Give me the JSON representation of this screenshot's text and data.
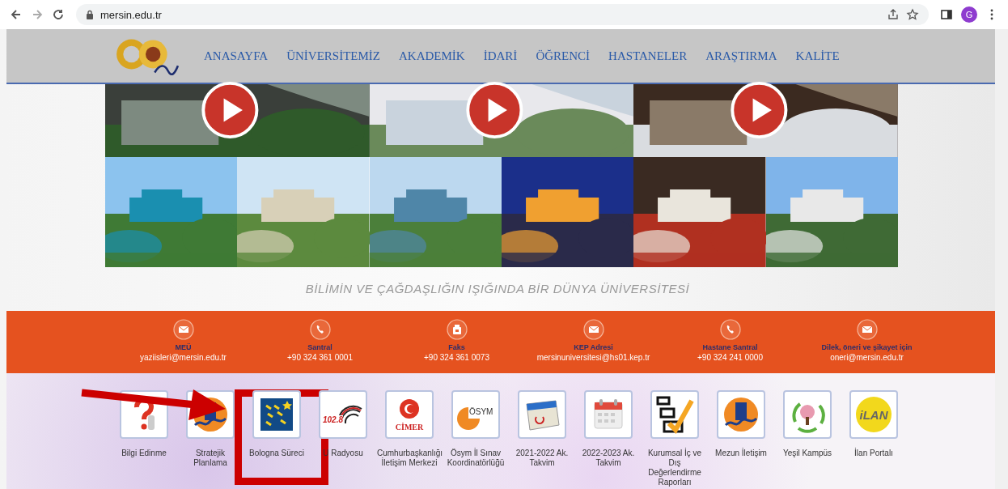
{
  "browser": {
    "url": "mersin.edu.tr",
    "profile_initial": "G"
  },
  "nav": {
    "items": [
      {
        "label": "ANASAYFA"
      },
      {
        "label": "ÜNİVERSİTEMİZ"
      },
      {
        "label": "AKADEMİK"
      },
      {
        "label": "İDARİ"
      },
      {
        "label": "ÖĞRENCİ"
      },
      {
        "label": "HASTANELER"
      },
      {
        "label": "ARAŞTIRMA"
      },
      {
        "label": "KALİTE"
      }
    ]
  },
  "slogan": "BİLİMİN VE ÇAĞDAŞLIĞIN IŞIĞINDA BİR DÜNYA ÜNİVERSİTESİ",
  "contacts": [
    {
      "kind": "mail",
      "label": "MEÜ",
      "value": "yaziisleri@mersin.edu.tr"
    },
    {
      "kind": "phone",
      "label": "Santral",
      "value": "+90 324 361 0001"
    },
    {
      "kind": "fax",
      "label": "Faks",
      "value": "+90 324 361 0073"
    },
    {
      "kind": "mail",
      "label": "KEP Adresi",
      "value": "mersinuniversitesi@hs01.kep.tr"
    },
    {
      "kind": "phone",
      "label": "Hastane Santral",
      "value": "+90 324 241 0000"
    },
    {
      "kind": "mail",
      "label": "Dilek, öneri ve şikayet için",
      "value": "oneri@mersin.edu.tr"
    }
  ],
  "links": [
    {
      "kind": "question",
      "label": "Bilgi Edinme",
      "highlighted": false
    },
    {
      "kind": "emblem",
      "label": "Stratejik Planlama",
      "highlighted": false
    },
    {
      "kind": "stars",
      "label": "Bologna Süreci",
      "highlighted": true
    },
    {
      "kind": "radio",
      "badge_text": "102.8",
      "label": "U Radyosu",
      "highlighted": false
    },
    {
      "kind": "cimer",
      "badge_text": "CİMER",
      "label": "Cumhurbaşkanlığı İletişim Merkezi",
      "highlighted": false
    },
    {
      "kind": "osym",
      "badge_text": "ÖSYM",
      "label": "Ösym İl Sınav Koordinatörlüğü",
      "highlighted": false
    },
    {
      "kind": "desk-calendar",
      "label": "2021-2022 Ak. Takvim",
      "highlighted": false
    },
    {
      "kind": "calendar",
      "label": "2022-2023 Ak. Takvim",
      "highlighted": false
    },
    {
      "kind": "checklist",
      "label": "Kurumsal İç ve Dış Değerlendirme Raporları",
      "highlighted": false
    },
    {
      "kind": "emblem",
      "label": "Mezun İletişim",
      "highlighted": false
    },
    {
      "kind": "tree",
      "label": "Yeşil Kampüs",
      "highlighted": false
    },
    {
      "kind": "ilan",
      "badge_text": "iLAN",
      "label": "İlan Portalı",
      "highlighted": false
    }
  ]
}
